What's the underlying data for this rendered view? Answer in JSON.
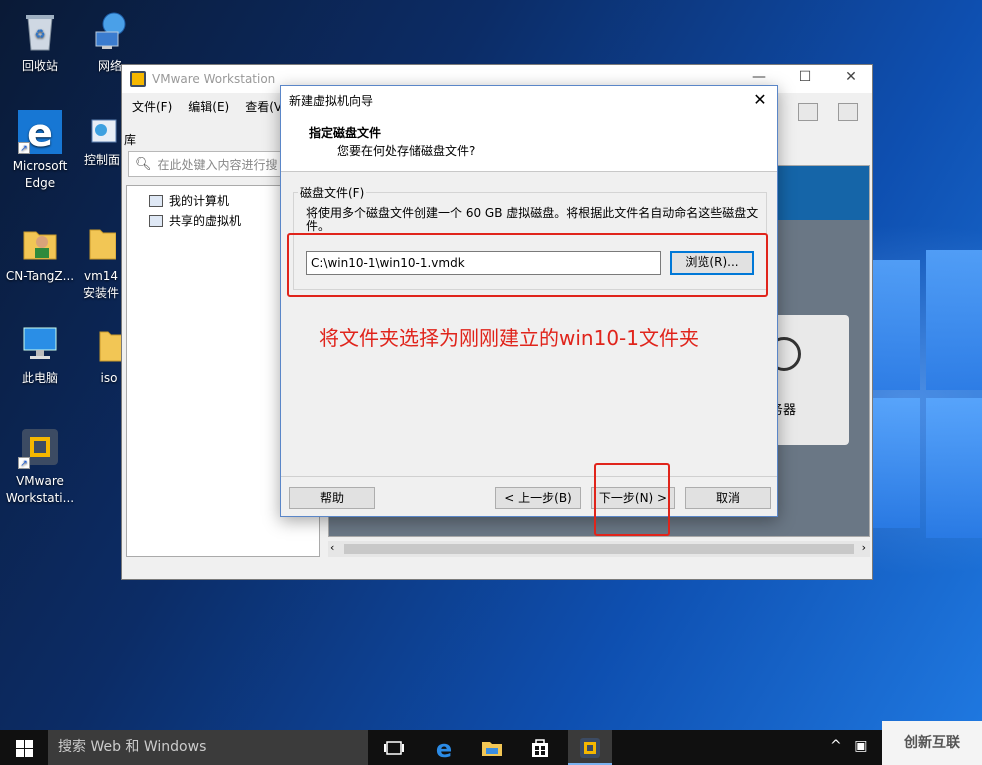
{
  "desktop": {
    "icons": [
      {
        "label": "回收站"
      },
      {
        "label": "网络"
      },
      {
        "label": "Microsoft Edge"
      },
      {
        "label": "控制面板"
      },
      {
        "label": "CN-TangZ..."
      },
      {
        "label": "vm14安装件"
      },
      {
        "label": "此电脑"
      },
      {
        "label": "iso"
      },
      {
        "label": "VMware Workstati..."
      }
    ]
  },
  "vmware": {
    "title": "VMware Workstation",
    "menu": [
      "文件(F)",
      "编辑(E)",
      "查看(V)"
    ],
    "library_label": "库",
    "search_placeholder": "在此处键入内容进行搜",
    "tree": [
      "我的计算机",
      "共享的虚拟机"
    ],
    "server_text": "服务器"
  },
  "wizard": {
    "title": "新建虚拟机向导",
    "heading": "指定磁盘文件",
    "subheading": "您要在何处存储磁盘文件?",
    "group_label": "磁盘文件(F)",
    "description": "将使用多个磁盘文件创建一个 60 GB 虚拟磁盘。将根据此文件名自动命名这些磁盘文件。",
    "path_value": "C:\\win10-1\\win10-1.vmdk",
    "browse_label": "浏览(R)...",
    "help_label": "帮助",
    "back_label": "< 上一步(B)",
    "next_label": "下一步(N) >",
    "cancel_label": "取消"
  },
  "annotation": {
    "text": "将文件夹选择为刚刚建立的win10-1文件夹",
    "color": "#e0241b"
  },
  "taskbar": {
    "search_text": "搜索 Web 和 Windows"
  },
  "watermark": {
    "text": "创新互联"
  }
}
